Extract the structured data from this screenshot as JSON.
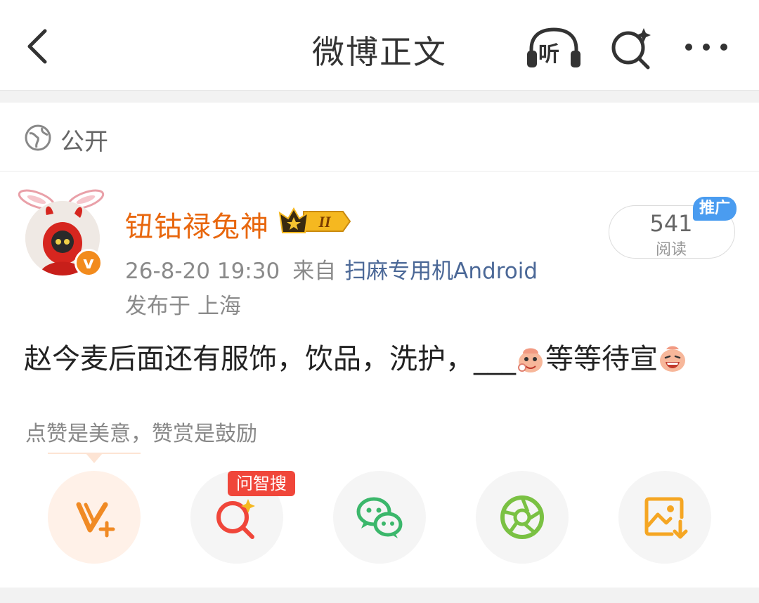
{
  "header": {
    "title": "微博正文",
    "listen_label": "听",
    "icons": [
      "back-icon",
      "headphones-icon",
      "ai-search-icon",
      "more-icon"
    ]
  },
  "privacy": {
    "label": "公开",
    "icon": "globe-icon"
  },
  "post": {
    "author": "钮钴禄兔神",
    "level_badge": "II",
    "verified_mark": "v",
    "timestamp": "26-8-20 19:30",
    "source_prefix": "来自",
    "source": "扫麻专用机Android",
    "location": "发布于 上海",
    "content_part1": "赵今麦后面还有服饰，饮品，洗护，___",
    "content_part2": "等等待宣",
    "read_count": "541",
    "read_label": "阅读",
    "promo_label": "推广"
  },
  "reward": {
    "text": "点赞是美意，赞赏是鼓励"
  },
  "actions": {
    "ai_search_tag": "问智搜",
    "items": [
      "vplus-icon",
      "ai-search-icon",
      "wechat-icon",
      "moments-icon",
      "save-image-icon"
    ]
  },
  "colors": {
    "author": "#e8670e",
    "source_link": "#4b6897",
    "promo": "#4a9cf0",
    "ai_tag": "#f0463a",
    "vplus": "#f08a24",
    "wechat": "#3bb76b",
    "moments": "#7ac143",
    "save": "#f5a623"
  }
}
